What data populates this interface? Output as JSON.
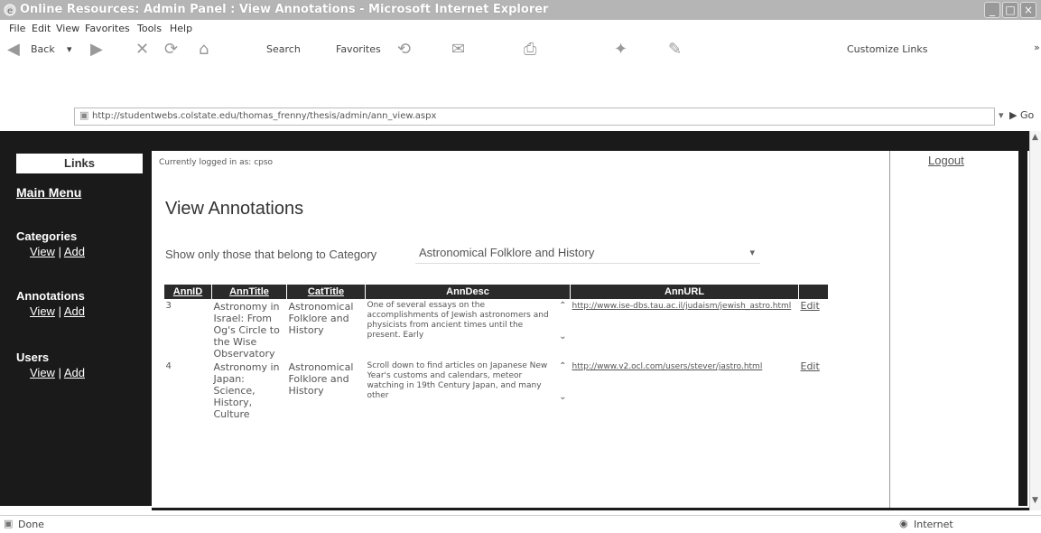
{
  "window": {
    "title": "Online Resources: Admin Panel : View Annotations - Microsoft Internet Explorer"
  },
  "menu": [
    "File",
    "Edit",
    "View",
    "Favorites",
    "Tools",
    "Help"
  ],
  "toolbar": {
    "back_label": "Back",
    "search_label": "Search",
    "favorites_label": "Favorites",
    "customize_links_label": "Customize Links"
  },
  "address": {
    "url": "http://studentwebs.colstate.edu/thomas_frenny/thesis/admin/ann_view.aspx",
    "go_label": "Go"
  },
  "sidebar": {
    "heading": "Links",
    "main_menu": "Main Menu",
    "sections": [
      {
        "title": "Categories",
        "view": "View",
        "sep": " | ",
        "add": "Add"
      },
      {
        "title": "Annotations",
        "view": "View",
        "sep": " | ",
        "add": "Add"
      },
      {
        "title": "Users",
        "view": "View",
        "sep": " | ",
        "add": "Add"
      }
    ]
  },
  "page": {
    "logged_in": "Currently logged in as: cpso",
    "logout": "Logout",
    "title": "View Annotations",
    "filter_label": "Show only those that belong to Category",
    "filter_value": "Astronomical Folklore and History"
  },
  "table": {
    "headers": [
      "AnnID",
      "AnnTitle",
      "CatTitle",
      "AnnDesc",
      "AnnURL",
      ""
    ],
    "rows": [
      {
        "id": "3",
        "title": "Astronomy in Israel: From Og's Circle to the Wise Observatory",
        "cat": "Astronomical Folklore and History",
        "desc": "One of several essays on the accomplishments of Jewish astronomers and physicists from ancient times until the present. Early",
        "url": "http://www.ise-dbs.tau.ac.il/judaism/jewish_astro.html",
        "edit": "Edit"
      },
      {
        "id": "4",
        "title": "Astronomy in Japan: Science, History, Culture",
        "cat": "Astronomical Folklore and History",
        "desc": "Scroll down to find articles on Japanese New Year's customs and calendars, meteor watching in 19th Century Japan, and many other",
        "url": "http://www.v2.ocl.com/users/stever/jastro.html",
        "edit": "Edit"
      }
    ]
  },
  "status": {
    "left": "Done",
    "zone": "Internet"
  }
}
